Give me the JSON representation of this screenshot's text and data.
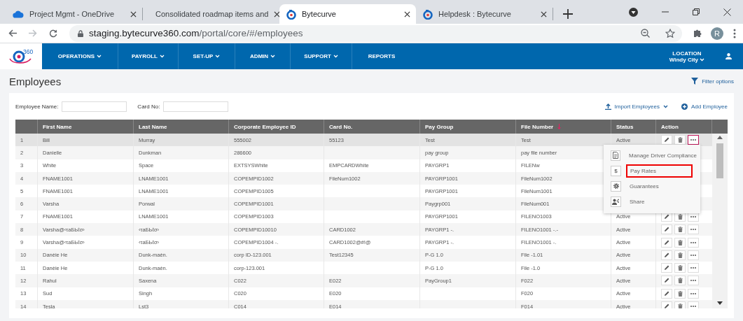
{
  "browser": {
    "tabs": [
      {
        "title": "Project Mgmt - OneDrive",
        "kind": "cloud",
        "selected": false
      },
      {
        "title": "Consolidated roadmap items and",
        "kind": "sheet",
        "selected": false
      },
      {
        "title": "Bytecurve",
        "kind": "brand",
        "selected": true
      },
      {
        "title": "Helpdesk : Bytecurve",
        "kind": "brand",
        "selected": false
      }
    ],
    "url_host": "staging.bytecurve360.com",
    "url_path": "/portal/core/#/employees",
    "avatar": "R"
  },
  "app": {
    "logo_text": "360",
    "nav": [
      {
        "label": "OPERATIONS",
        "dropdown": true
      },
      {
        "label": "PAYROLL",
        "dropdown": true
      },
      {
        "label": "SET-UP",
        "dropdown": true
      },
      {
        "label": "ADMIN",
        "dropdown": true
      },
      {
        "label": "SUPPORT",
        "dropdown": true
      },
      {
        "label": "REPORTS",
        "dropdown": false
      }
    ],
    "location_label": "LOCATION",
    "location_value": "Windy City"
  },
  "page": {
    "title": "Employees",
    "filter_options": "Filter options",
    "filters": [
      {
        "label": "Employee Name:"
      },
      {
        "label": "Card No:"
      }
    ],
    "import_button": "Import Employees",
    "add_button": "Add Employee"
  },
  "table": {
    "columns": [
      {
        "sorted": false
      },
      {
        "label": "First Name",
        "sorted": false
      },
      {
        "label": "Last Name",
        "sorted": false
      },
      {
        "label": "Corporate Employee ID",
        "sorted": false
      },
      {
        "label": "Card No.",
        "sorted": false
      },
      {
        "label": "Pay Group",
        "sorted": false
      },
      {
        "label": "File Number",
        "sorted": true
      },
      {
        "label": "Status",
        "sorted": false
      },
      {
        "label": "Action",
        "sorted": false
      }
    ],
    "rows": [
      {
        "cells": [
          "1",
          "Bill",
          "Murray",
          "555002",
          "55123",
          "Test",
          "Test",
          "Active"
        ],
        "actions": true,
        "menu_open": true,
        "selected": true
      },
      {
        "cells": [
          "2",
          "Danielle",
          "Dunkman",
          "286600",
          null,
          "pay group",
          "pay file number",
          null
        ],
        "selected": false
      },
      {
        "cells": [
          "3",
          "White",
          "Space",
          "EXTSYSWhite",
          "EMPCARDWhite",
          "PAYGRP1",
          "FILENw",
          null
        ],
        "selected": false
      },
      {
        "cells": [
          "4",
          "FNAME1001",
          "LNAME1001",
          "COPEMPID1002",
          "FileNum1002",
          "PAYGRP1001",
          "FileNum1002",
          null
        ],
        "selected": false
      },
      {
        "cells": [
          "5",
          "FNAME1001",
          "LNAME1001",
          "COPEMPID1005",
          null,
          "PAYGRP1001",
          "FileNum1001",
          null
        ],
        "selected": false
      },
      {
        "cells": [
          "6",
          "Varsha",
          "Porwal",
          "COPEMPID1001",
          null,
          "Paygrp001",
          "FileNum001",
          null
        ],
        "selected": false
      },
      {
        "cells": [
          "7",
          "FNAME1001",
          "LNAME1001",
          "COPEMPID1003",
          null,
          "PAYGRP1001",
          "FILENO1003",
          "Active"
        ],
        "actions": true,
        "selected": false
      },
      {
        "cells": [
          "8",
          "Varsha@‹τaБЬℓσ›",
          "‹τaБЬℓσ›",
          "COPEMPID10010",
          "CARD1002",
          "PAYGRP1 -.",
          "FILENO1001 -.-",
          "Active"
        ],
        "actions": true,
        "selected": false
      },
      {
        "cells": [
          "9",
          "Varsha@‹τaБЬℓσ›",
          "‹τaБЬℓσ›",
          "COPEMPID1004 -.",
          "CARD1002@#!@",
          "PAYGRP1 -.",
          "FILENO1001 -.",
          "Active"
        ],
        "actions": true,
        "selected": false
      },
      {
        "cells": [
          "10",
          "Danèie He",
          "Dunk-maèn.",
          "corp ID-123.001",
          "Test12345",
          "P-G 1.0",
          "File -1.01",
          "Active"
        ],
        "actions": true,
        "selected": false
      },
      {
        "cells": [
          "11",
          "Danèie He",
          "Dunk-maèn.",
          "corp-123.001",
          null,
          "P-G 1.0",
          "File -1.0",
          "Active"
        ],
        "actions": true,
        "selected": false
      },
      {
        "cells": [
          "12",
          "Rahul",
          "Saxena",
          "C022",
          "E022",
          "PayGroup1",
          "F022",
          "Active"
        ],
        "actions": true,
        "selected": false
      },
      {
        "cells": [
          "13",
          "Sud",
          "Singh",
          "C020",
          "E020",
          null,
          "F020",
          "Active"
        ],
        "actions": true,
        "selected": false
      },
      {
        "cells": [
          "14",
          "Tesla",
          "Lst3",
          "C014",
          "E014",
          null,
          "F014",
          "Active"
        ],
        "actions": true,
        "selected": false
      }
    ],
    "menu": [
      {
        "label": "Manage Driver Compliance",
        "kind": "document",
        "highlighted": false
      },
      {
        "label": "Pay Rates",
        "kind": "glyph",
        "glyph": "$",
        "highlighted": true
      },
      {
        "label": "Guarantees",
        "kind": "gear",
        "highlighted": false
      },
      {
        "label": "Share",
        "kind": "person",
        "highlighted": false
      }
    ]
  }
}
